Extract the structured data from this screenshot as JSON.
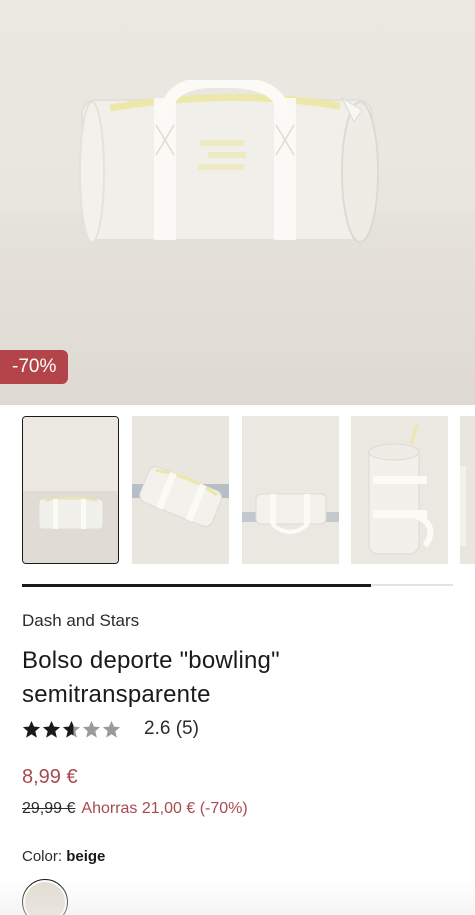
{
  "hero": {
    "image_label": "product-photo-duffel-bag",
    "discount_badge": "-70%"
  },
  "thumbnails": [
    {
      "name": "thumbnail-front",
      "selected": true
    },
    {
      "name": "thumbnail-angled",
      "selected": false
    },
    {
      "name": "thumbnail-handles",
      "selected": false
    },
    {
      "name": "thumbnail-upright",
      "selected": false
    },
    {
      "name": "thumbnail-partial",
      "selected": false
    }
  ],
  "gallery_scroll_progress": 0.81,
  "product": {
    "brand": "Dash and Stars",
    "title": "Bolso deporte \"bowling\" semitransparente",
    "rating_value": 2.6,
    "rating_text": "2.6 (5)",
    "max_stars": 5,
    "price": "8,99 €",
    "old_price": "29,99 €",
    "savings": "Ahorras 21,00 € (-70%)",
    "color_label": "Color:",
    "color_value": "beige"
  },
  "colors": {
    "accent": "#a84a4f",
    "badge": "#b2444a",
    "swatch_beige": "#e3ddd0",
    "star_filled": "#1a1a1a",
    "star_empty": "#9a9a9a"
  }
}
